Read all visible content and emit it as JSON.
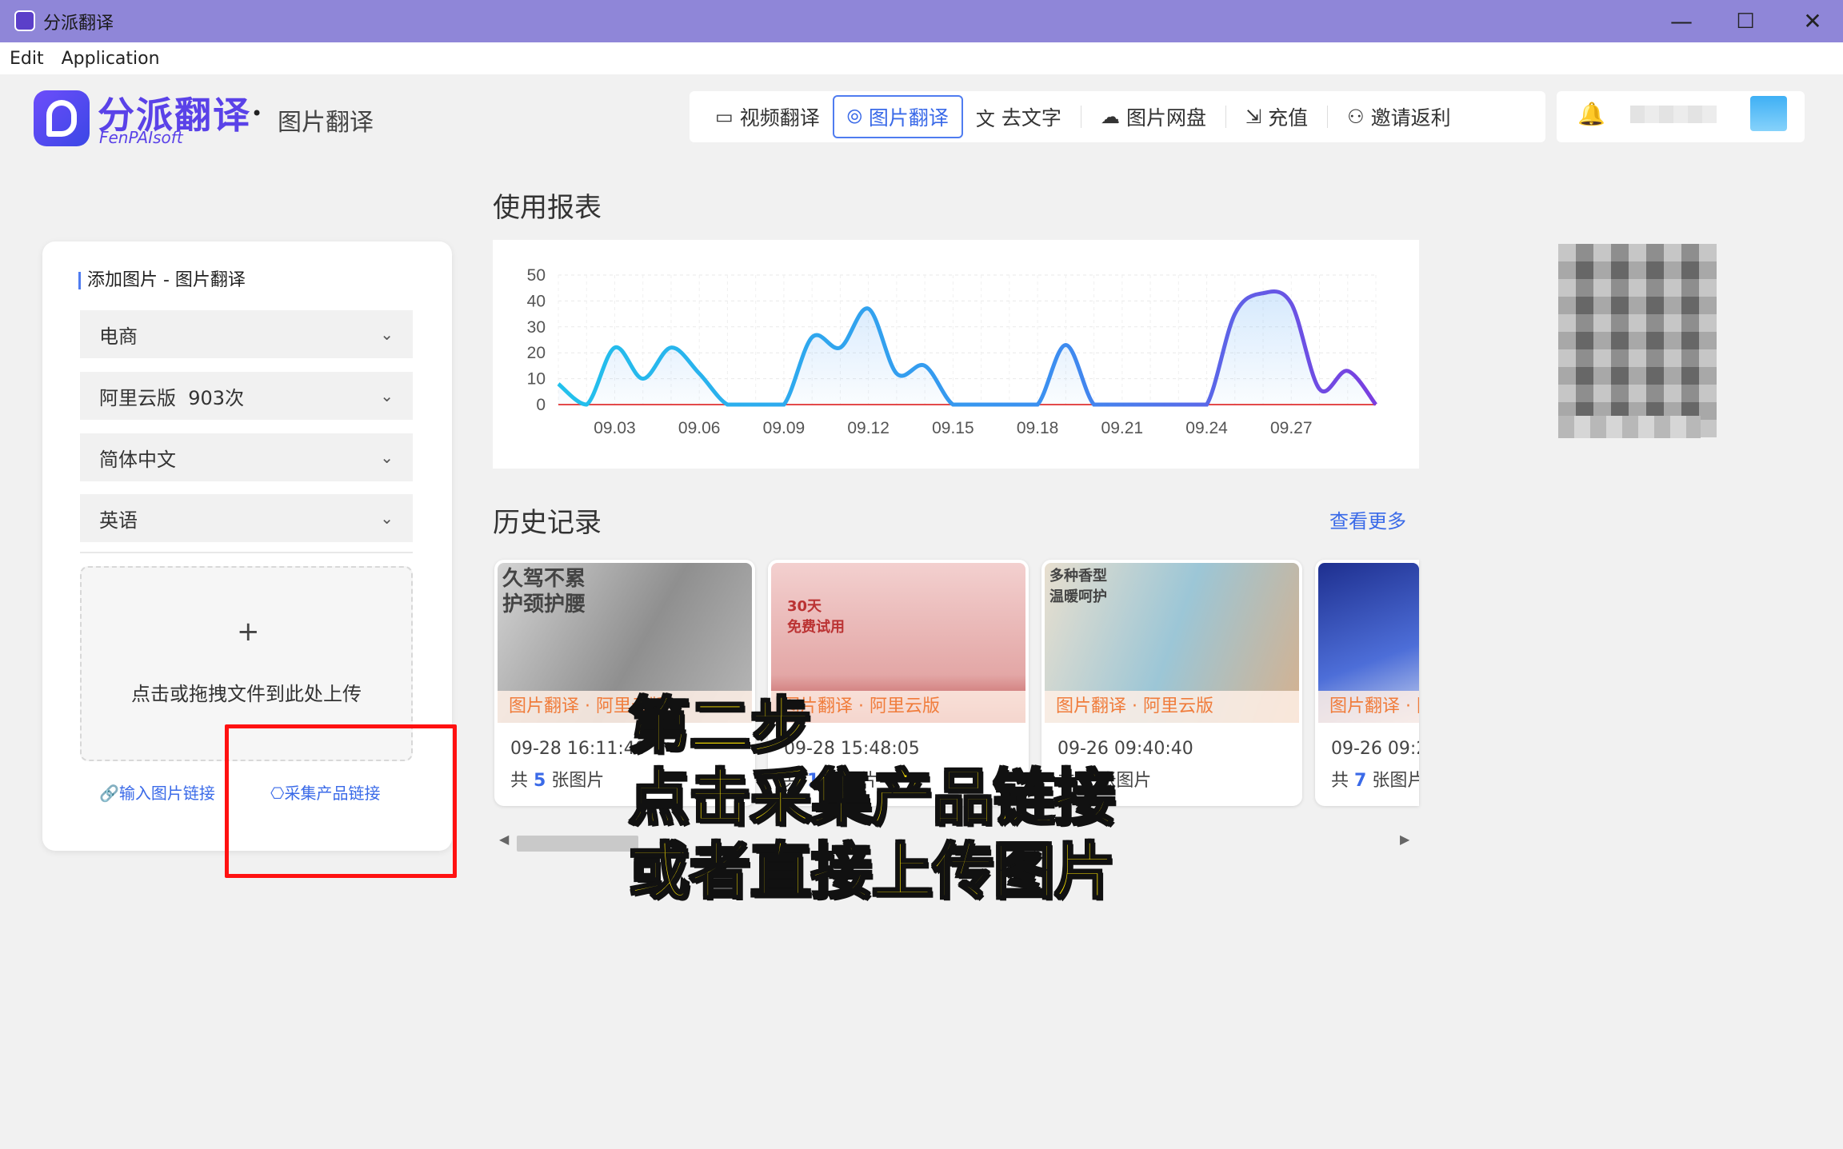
{
  "window": {
    "title": "分派翻译",
    "minimize": "—",
    "maximize": "☐",
    "close": "✕"
  },
  "menu": [
    "Edit",
    "Application"
  ],
  "brand": {
    "name_cn": "分派翻译",
    "name_en": "FenPAIsoft",
    "dot": "•",
    "section": "图片翻译"
  },
  "nav": [
    {
      "label": "视频翻译",
      "icon": "video-icon",
      "glyph": "▭"
    },
    {
      "label": "图片翻译",
      "icon": "image-translate-icon",
      "glyph": "⦾",
      "active": true
    },
    {
      "label": "去文字",
      "icon": "translate-icon",
      "glyph": "文"
    },
    {
      "label": "图片网盘",
      "icon": "cloud-icon",
      "glyph": "☁"
    },
    {
      "label": "充值",
      "icon": "login-icon",
      "glyph": "⇲"
    },
    {
      "label": "邀请返利",
      "icon": "user-add-icon",
      "glyph": "⚇"
    }
  ],
  "bell_glyph": "🔔",
  "panel": {
    "title": "添加图片 - 图片翻译",
    "selects": [
      "电商",
      "阿里云版  903次",
      "简体中文",
      "英语"
    ],
    "chevron": "⌄",
    "plus": "+",
    "drop_text": "点击或拖拽文件到此处上传",
    "link_image": "🔗输入图片链接",
    "link_collect": "⎔采集产品链接"
  },
  "usage": {
    "title": "使用报表"
  },
  "chart_data": {
    "type": "line",
    "title": "",
    "xlabel": "",
    "ylabel": "",
    "ylim": [
      0,
      50
    ],
    "yticks": [
      0,
      10,
      20,
      30,
      40,
      50
    ],
    "xticks": [
      "09.03",
      "09.06",
      "09.09",
      "09.12",
      "09.15",
      "09.18",
      "09.21",
      "09.24",
      "09.27"
    ],
    "x": [
      "09.01",
      "09.02",
      "09.03",
      "09.04",
      "09.05",
      "09.06",
      "09.07",
      "09.08",
      "09.09",
      "09.10",
      "09.11",
      "09.12",
      "09.13",
      "09.14",
      "09.15",
      "09.16",
      "09.17",
      "09.18",
      "09.19",
      "09.20",
      "09.21",
      "09.22",
      "09.23",
      "09.24",
      "09.25",
      "09.26",
      "09.27",
      "09.28",
      "09.29",
      "09.30"
    ],
    "series": [
      {
        "color": "#2db8f0",
        "values": [
          8,
          0,
          22,
          10,
          22,
          12,
          0,
          0,
          0,
          26,
          22,
          37,
          12,
          15,
          0,
          0,
          0,
          0,
          23,
          0,
          0,
          0,
          0,
          0,
          35,
          43,
          39,
          6,
          13,
          0
        ]
      },
      {
        "color": "#e34a4a",
        "values": [
          0,
          0,
          0,
          0,
          0,
          0,
          0,
          0,
          0,
          0,
          0,
          0,
          0,
          0,
          0,
          0,
          0,
          0,
          0,
          0,
          0,
          0,
          0,
          0,
          0,
          0,
          0,
          0,
          0,
          0
        ]
      }
    ]
  },
  "history": {
    "title": "历史记录",
    "more": "查看更多",
    "items": [
      {
        "tag": "图片翻译 · 阿里云版",
        "date": "09-28 16:11:40",
        "count_pre": "共",
        "count": "5",
        "count_post": "张图片",
        "thumb_text": "久驾不累\n护颈护腰"
      },
      {
        "tag": "图片翻译 · 阿里云版",
        "date": "09-28 15:48:05",
        "count_pre": "共",
        "count": "1",
        "count_post": "张图片",
        "thumb_text": "30天\n免费试用"
      },
      {
        "tag": "图片翻译 · 阿里云版",
        "date": "09-26 09:40:40",
        "count_pre": "共",
        "count": "3",
        "count_post": "张图片",
        "thumb_text": "多种香型\n温暖呵护"
      },
      {
        "tag": "图片翻译 · 阿里云版",
        "date": "09-26 09:2",
        "count_pre": "共",
        "count": "7",
        "count_post": "张图片",
        "thumb_text": ""
      }
    ]
  },
  "scroll": {
    "left": "◀",
    "right": "▶"
  },
  "overlay": [
    "第二步",
    "点击采集产品链接",
    "或者直接上传图片"
  ]
}
